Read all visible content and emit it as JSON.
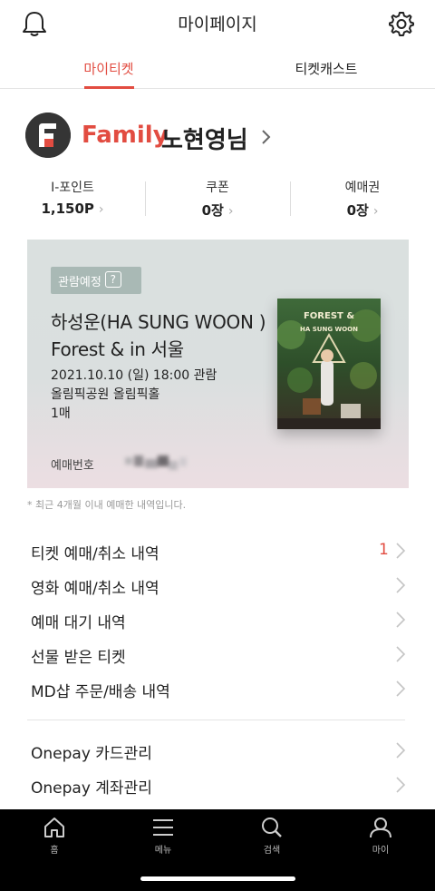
{
  "header": {
    "title": "마이페이지",
    "left_icon": "bell-icon",
    "right_icon": "gear-icon"
  },
  "tabs": [
    {
      "label": "마이티켓",
      "active": true
    },
    {
      "label": "티켓캐스트",
      "active": false
    }
  ],
  "profile": {
    "logo_icon": "family-grade-logo-icon",
    "grade": "Family",
    "name": "노현영님"
  },
  "stats": [
    {
      "label": "I-포인트",
      "value": "1,150P"
    },
    {
      "label": "쿠폰",
      "value": "0장"
    },
    {
      "label": "예매권",
      "value": "0장"
    }
  ],
  "ticket": {
    "status_badge": "관람예정",
    "help_mark": "?",
    "title": "하성운(HA SUNG WOON ) Forest & in 서울",
    "date": "2021.10.10 (일) 18:00 관람",
    "venue": "올림픽공원 올림픽홀",
    "count": "1매",
    "reservation_label": "예매번호",
    "poster_title": "FOREST &",
    "poster_artist": "HA SUNG WOON"
  },
  "note": "* 최근 4개월 이내 예매한 내역입니다.",
  "menu": [
    {
      "label": "티켓 예매/취소 내역",
      "count": "1"
    },
    {
      "label": "영화 예매/취소 내역",
      "count": ""
    },
    {
      "label": "예매 대기 내역",
      "count": ""
    },
    {
      "label": "선물 받은 티켓",
      "count": ""
    },
    {
      "label": "MD샵 주문/배송 내역",
      "count": ""
    }
  ],
  "menu2": [
    {
      "label": "Onepay 카드관리"
    },
    {
      "label": "Onepay 계좌관리"
    }
  ],
  "bottom_nav": [
    {
      "label": "홈",
      "icon": "home-icon"
    },
    {
      "label": "메뉴",
      "icon": "menu-icon"
    },
    {
      "label": "검색",
      "icon": "search-icon"
    },
    {
      "label": "마이",
      "icon": "user-icon"
    }
  ],
  "colors": {
    "accent": "#e24c41",
    "badge": "#a9b9b5",
    "nav_bg": "#000000"
  }
}
